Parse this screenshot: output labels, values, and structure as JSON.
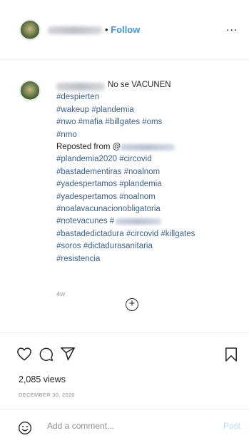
{
  "header": {
    "follow_separator": "•",
    "follow_label": "Follow",
    "more_label": "..."
  },
  "caption": {
    "first_line_text": "No se VACUNEN",
    "lines": [
      "#despierten",
      "#wakeup #plandemia",
      "#nwo #mafia #billgates #oms",
      "#nmo"
    ],
    "reposted_label": "Reposted from @",
    "lines_after_repost": [
      "#plandemia2020 #circovid",
      "#bastadementiras #noalnom",
      "#yadespertamos #plandemia",
      "#yadespertamos #noalnom",
      "#noalavacunacionobligatoria"
    ],
    "notevacunes": "#notevacunes #",
    "lines_end": [
      "#bastadedictadura #circovid #killgates",
      "#soros #dictadurasanitaria",
      "#resistencia"
    ]
  },
  "post": {
    "time_ago": "4w",
    "views": "2,085 views",
    "date": "DECEMBER 30, 2020"
  },
  "comment": {
    "placeholder": "Add a comment...",
    "post_label": "Post"
  },
  "icons": {
    "like": "heart-icon",
    "comment": "comment-icon",
    "share": "share-icon",
    "save": "bookmark-icon",
    "emoji": "smiley-icon",
    "load_more": "plus-circle-icon"
  }
}
